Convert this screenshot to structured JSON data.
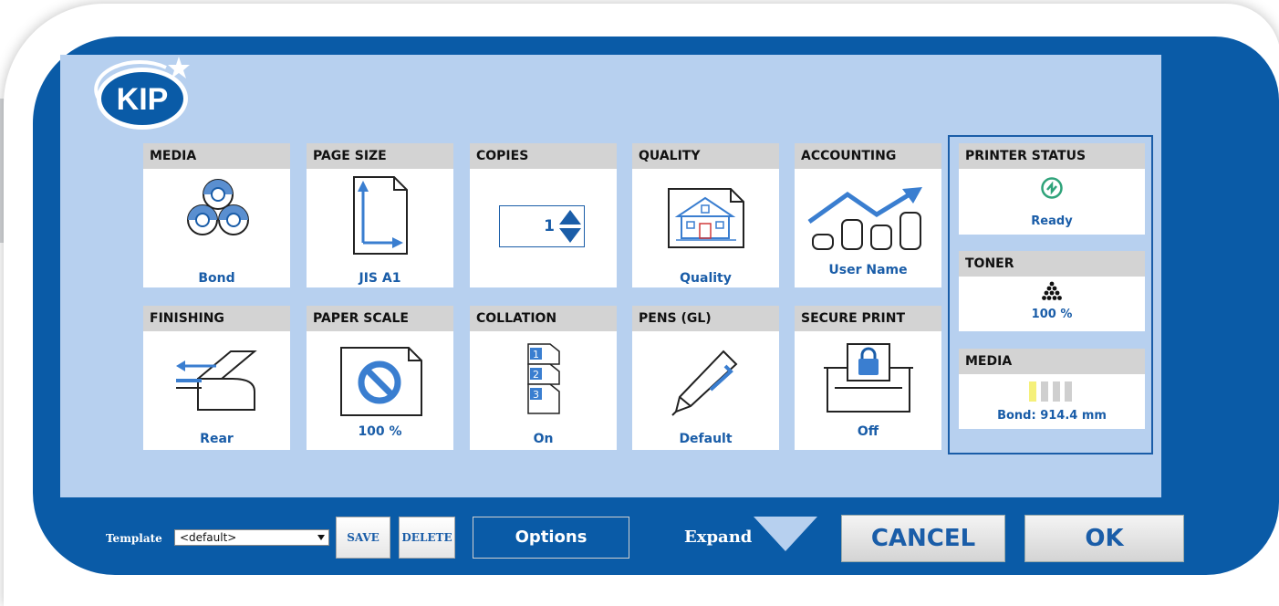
{
  "brand": {
    "logo_text": "KIP"
  },
  "tiles": {
    "media": {
      "title": "MEDIA",
      "value": "Bond"
    },
    "page_size": {
      "title": "PAGE SIZE",
      "value": "JIS A1"
    },
    "copies": {
      "title": "COPIES",
      "value": "1"
    },
    "quality": {
      "title": "QUALITY",
      "value": "Quality"
    },
    "accounting": {
      "title": "ACCOUNTING",
      "value": "User Name"
    },
    "finishing": {
      "title": "FINISHING",
      "value": "Rear"
    },
    "paper_scale": {
      "title": "PAPER SCALE",
      "value": "100 %"
    },
    "collation": {
      "title": "COLLATION",
      "value": "On",
      "pages": [
        "1",
        "2",
        "3"
      ]
    },
    "pens": {
      "title": "PENS (GL)",
      "value": "Default"
    },
    "secure_print": {
      "title": "SECURE PRINT",
      "value": "Off"
    }
  },
  "status": {
    "printer": {
      "title": "PRINTER STATUS",
      "value": "Ready"
    },
    "toner": {
      "title": "TONER",
      "value": "100 %"
    },
    "media": {
      "title": "MEDIA",
      "value": "Bond: 914.4 mm"
    }
  },
  "footer": {
    "template_label": "Template",
    "template_value": "<default>",
    "save_label": "SAVE",
    "delete_label": "DELETE",
    "options_label": "Options",
    "expand_label": "Expand",
    "cancel_label": "CANCEL",
    "ok_label": "OK"
  },
  "colors": {
    "frame_blue": "#0a5ba7",
    "panel_light_blue": "#b7d0ef",
    "accent_blue": "#1a5da8",
    "status_green": "#2fa37a",
    "media_roll_yellow": "#f5f07a"
  }
}
